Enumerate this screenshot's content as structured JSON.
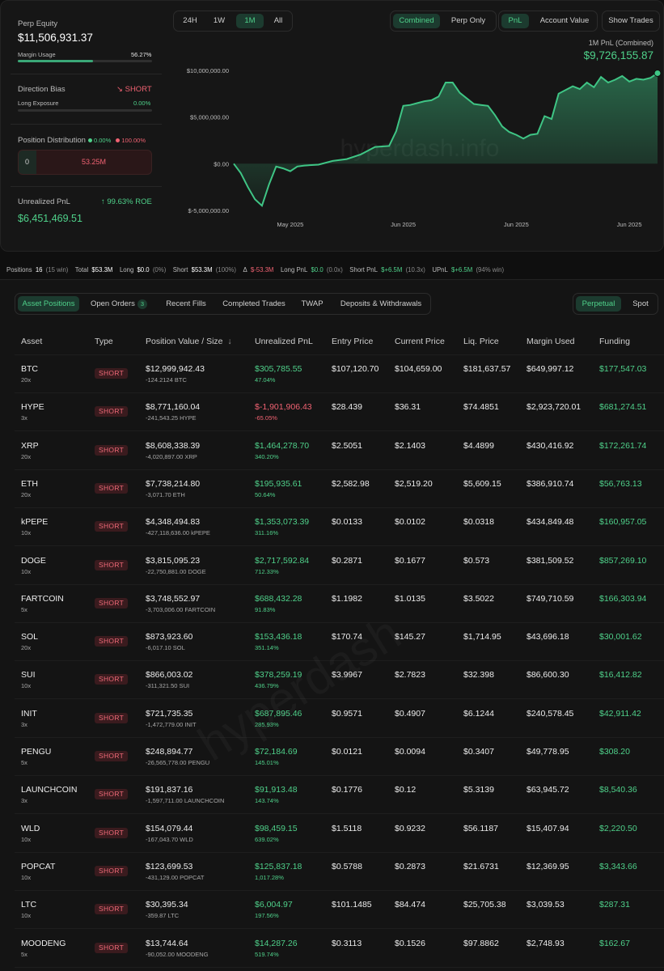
{
  "summary": {
    "perp_equity_label": "Perp Equity",
    "perp_equity_value": "$11,506,931.37",
    "margin_usage_label": "Margin Usage",
    "margin_usage_value": "56.27%",
    "margin_usage_fraction": 0.5627,
    "direction_bias_label": "Direction Bias",
    "direction_bias_value": "SHORT",
    "direction_bias_arrow": "↘",
    "long_exposure_label": "Long Exposure",
    "long_exposure_value": "0.00%",
    "position_distribution_label": "Position Distribution",
    "dist_long_pct": "0.00%",
    "dist_short_pct": "100.00%",
    "dist_long_value": "0",
    "dist_short_value": "53.25M",
    "unrealized_pnl_label": "Unrealized PnL",
    "roe_value": "99.63% ROE",
    "roe_arrow": "↑",
    "unrealized_pnl_value": "$6,451,469.51"
  },
  "chart_controls": {
    "ranges": [
      "24H",
      "1W",
      "1M",
      "All"
    ],
    "active_range": "1M",
    "modes": [
      "Combined",
      "Perp Only"
    ],
    "active_mode": "Combined",
    "metrics": [
      "PnL",
      "Account Value"
    ],
    "active_metric": "PnL",
    "show_trades": "Show Trades",
    "title": "1M PnL (Combined)",
    "current_value": "$9,726,155.87",
    "watermark": "hyperdash.info"
  },
  "chart_data": {
    "type": "area",
    "title": "1M PnL (Combined)",
    "xlabel": "",
    "ylabel": "",
    "ylim": [
      -5000000,
      10000000
    ],
    "y_ticks": [
      "$10,000,000.00",
      "$5,000,000.00",
      "$0.00",
      "$-5,000,000.00"
    ],
    "y_tick_values": [
      10000000,
      5000000,
      0,
      -5000000
    ],
    "x_ticks": [
      "May 2025",
      "Jun 2025",
      "Jun 2025",
      "Jun 2025"
    ],
    "x_tick_positions": [
      4,
      12,
      20,
      28
    ],
    "x": [
      0,
      0.5,
      1,
      1.5,
      2,
      2.5,
      3,
      3.5,
      4,
      4.5,
      5,
      6,
      7,
      8,
      9,
      10,
      11,
      11.5,
      12,
      12.5,
      13,
      13.5,
      14,
      14.5,
      15,
      15.5,
      16,
      17,
      17.5,
      18,
      18.5,
      19,
      19.5,
      20,
      20.5,
      21,
      21.5,
      22,
      22.5,
      23,
      24,
      24.5,
      25,
      25.5,
      26,
      26.5,
      27,
      27.5,
      28,
      28.5,
      29,
      29.5,
      30
    ],
    "y": [
      0,
      -1000000,
      -2500000,
      -3800000,
      -4500000,
      -2200000,
      -300000,
      -500000,
      -800000,
      -300000,
      -200000,
      -100000,
      300000,
      500000,
      1000000,
      1800000,
      1900000,
      3500000,
      6200000,
      6300000,
      6500000,
      6700000,
      6800000,
      7200000,
      8700000,
      8700000,
      7600000,
      6400000,
      6300000,
      6200000,
      5200000,
      4000000,
      3400000,
      3100000,
      2700000,
      3100000,
      3200000,
      5100000,
      4800000,
      7500000,
      8300000,
      8000000,
      8700000,
      8200000,
      9300000,
      8700000,
      9000000,
      9400000,
      8800000,
      9100000,
      9000000,
      9200000,
      9700000
    ],
    "color": "#3fc585",
    "grid": false
  },
  "stats": {
    "positions_label": "Positions",
    "positions_value": "16",
    "positions_win": "(15 win)",
    "total_label": "Total",
    "total_value": "$53.3M",
    "long_label": "Long",
    "long_value": "$0.0",
    "long_pct": "(0%)",
    "short_label": "Short",
    "short_value": "$53.3M",
    "short_pct": "(100%)",
    "delta_label": "Δ",
    "delta_value": "$-53.3M",
    "long_pnl_label": "Long PnL",
    "long_pnl_value": "$0.0",
    "long_pnl_mult": "(0.0x)",
    "short_pnl_label": "Short PnL",
    "short_pnl_value": "$+6.5M",
    "short_pnl_mult": "(10.3x)",
    "upnl_label": "UPnL",
    "upnl_value": "$+6.5M",
    "upnl_win": "(94% win)"
  },
  "tabs": {
    "items": [
      "Asset Positions",
      "Open Orders",
      "Recent Fills",
      "Completed Trades",
      "TWAP",
      "Deposits & Withdrawals"
    ],
    "open_orders_count": "3",
    "active": "Asset Positions",
    "market_toggle": [
      "Perpetual",
      "Spot"
    ],
    "market_active": "Perpetual"
  },
  "table": {
    "headers": [
      "Asset",
      "Type",
      "Position Value / Size",
      "Unrealized PnL",
      "Entry Price",
      "Current Price",
      "Liq. Price",
      "Margin Used",
      "Funding"
    ],
    "sort_arrow": "↓",
    "watermark": "hyperdash",
    "rows": [
      {
        "asset": "BTC",
        "lev": "20x",
        "type": "SHORT",
        "value": "$12,999,942.43",
        "size": "-124.2124 BTC",
        "pnl": "$305,785.55",
        "roe": "47.04%",
        "pnl_neg": false,
        "entry": "$107,120.70",
        "current": "$104,659.00",
        "liq": "$181,637.57",
        "margin": "$649,997.12",
        "funding": "$177,547.03"
      },
      {
        "asset": "HYPE",
        "lev": "3x",
        "type": "SHORT",
        "value": "$8,771,160.04",
        "size": "-241,543.25 HYPE",
        "pnl": "$-1,901,906.43",
        "roe": "-65.05%",
        "pnl_neg": true,
        "entry": "$28.439",
        "current": "$36.31",
        "liq": "$74.4851",
        "margin": "$2,923,720.01",
        "funding": "$681,274.51"
      },
      {
        "asset": "XRP",
        "lev": "20x",
        "type": "SHORT",
        "value": "$8,608,338.39",
        "size": "-4,020,897.00 XRP",
        "pnl": "$1,464,278.70",
        "roe": "340.20%",
        "pnl_neg": false,
        "entry": "$2.5051",
        "current": "$2.1403",
        "liq": "$4.4899",
        "margin": "$430,416.92",
        "funding": "$172,261.74"
      },
      {
        "asset": "ETH",
        "lev": "20x",
        "type": "SHORT",
        "value": "$7,738,214.80",
        "size": "-3,071.70 ETH",
        "pnl": "$195,935.61",
        "roe": "50.64%",
        "pnl_neg": false,
        "entry": "$2,582.98",
        "current": "$2,519.20",
        "liq": "$5,609.15",
        "margin": "$386,910.74",
        "funding": "$56,763.13"
      },
      {
        "asset": "kPEPE",
        "lev": "10x",
        "type": "SHORT",
        "value": "$4,348,494.83",
        "size": "-427,118,636.00 kPEPE",
        "pnl": "$1,353,073.39",
        "roe": "311.16%",
        "pnl_neg": false,
        "entry": "$0.0133",
        "current": "$0.0102",
        "liq": "$0.0318",
        "margin": "$434,849.48",
        "funding": "$160,957.05"
      },
      {
        "asset": "DOGE",
        "lev": "10x",
        "type": "SHORT",
        "value": "$3,815,095.23",
        "size": "-22,750,881.00 DOGE",
        "pnl": "$2,717,592.84",
        "roe": "712.33%",
        "pnl_neg": false,
        "entry": "$0.2871",
        "current": "$0.1677",
        "liq": "$0.573",
        "margin": "$381,509.52",
        "funding": "$857,269.10"
      },
      {
        "asset": "FARTCOIN",
        "lev": "5x",
        "type": "SHORT",
        "value": "$3,748,552.97",
        "size": "-3,703,006.00 FARTCOIN",
        "pnl": "$688,432.28",
        "roe": "91.83%",
        "pnl_neg": false,
        "entry": "$1.1982",
        "current": "$1.0135",
        "liq": "$3.5022",
        "margin": "$749,710.59",
        "funding": "$166,303.94"
      },
      {
        "asset": "SOL",
        "lev": "20x",
        "type": "SHORT",
        "value": "$873,923.60",
        "size": "-6,017.10 SOL",
        "pnl": "$153,436.18",
        "roe": "351.14%",
        "pnl_neg": false,
        "entry": "$170.74",
        "current": "$145.27",
        "liq": "$1,714.95",
        "margin": "$43,696.18",
        "funding": "$30,001.62"
      },
      {
        "asset": "SUI",
        "lev": "10x",
        "type": "SHORT",
        "value": "$866,003.02",
        "size": "-311,321.50 SUI",
        "pnl": "$378,259.19",
        "roe": "436.79%",
        "pnl_neg": false,
        "entry": "$3.9967",
        "current": "$2.7823",
        "liq": "$32.398",
        "margin": "$86,600.30",
        "funding": "$16,412.82"
      },
      {
        "asset": "INIT",
        "lev": "3x",
        "type": "SHORT",
        "value": "$721,735.35",
        "size": "-1,472,779.00 INIT",
        "pnl": "$687,895.46",
        "roe": "285.93%",
        "pnl_neg": false,
        "entry": "$0.9571",
        "current": "$0.4907",
        "liq": "$6.1244",
        "margin": "$240,578.45",
        "funding": "$42,911.42"
      },
      {
        "asset": "PENGU",
        "lev": "5x",
        "type": "SHORT",
        "value": "$248,894.77",
        "size": "-26,565,778.00 PENGU",
        "pnl": "$72,184.69",
        "roe": "145.01%",
        "pnl_neg": false,
        "entry": "$0.0121",
        "current": "$0.0094",
        "liq": "$0.3407",
        "margin": "$49,778.95",
        "funding": "$308.20"
      },
      {
        "asset": "LAUNCHCOIN",
        "lev": "3x",
        "type": "SHORT",
        "value": "$191,837.16",
        "size": "-1,597,711.00 LAUNCHCOIN",
        "pnl": "$91,913.48",
        "roe": "143.74%",
        "pnl_neg": false,
        "entry": "$0.1776",
        "current": "$0.12",
        "liq": "$5.3139",
        "margin": "$63,945.72",
        "funding": "$8,540.36"
      },
      {
        "asset": "WLD",
        "lev": "10x",
        "type": "SHORT",
        "value": "$154,079.44",
        "size": "-167,043.70 WLD",
        "pnl": "$98,459.15",
        "roe": "639.02%",
        "pnl_neg": false,
        "entry": "$1.5118",
        "current": "$0.9232",
        "liq": "$56.1187",
        "margin": "$15,407.94",
        "funding": "$2,220.50"
      },
      {
        "asset": "POPCAT",
        "lev": "10x",
        "type": "SHORT",
        "value": "$123,699.53",
        "size": "-431,129.00 POPCAT",
        "pnl": "$125,837.18",
        "roe": "1,017.28%",
        "pnl_neg": false,
        "entry": "$0.5788",
        "current": "$0.2873",
        "liq": "$21.6731",
        "margin": "$12,369.95",
        "funding": "$3,343.66"
      },
      {
        "asset": "LTC",
        "lev": "10x",
        "type": "SHORT",
        "value": "$30,395.34",
        "size": "-359.87 LTC",
        "pnl": "$6,004.97",
        "roe": "197.56%",
        "pnl_neg": false,
        "entry": "$101.1485",
        "current": "$84.474",
        "liq": "$25,705.38",
        "margin": "$3,039.53",
        "funding": "$287.31"
      },
      {
        "asset": "MOODENG",
        "lev": "5x",
        "type": "SHORT",
        "value": "$13,744.64",
        "size": "-90,052.00 MOODENG",
        "pnl": "$14,287.26",
        "roe": "519.74%",
        "pnl_neg": false,
        "entry": "$0.3113",
        "current": "$0.1526",
        "liq": "$97.8862",
        "margin": "$2,748.93",
        "funding": "$162.67"
      }
    ]
  },
  "colors": {
    "accent_green": "#4fd18a",
    "negative_red": "#f06272",
    "short_tag_bg": "#3a1b1e",
    "background": "#0f0f0f"
  }
}
